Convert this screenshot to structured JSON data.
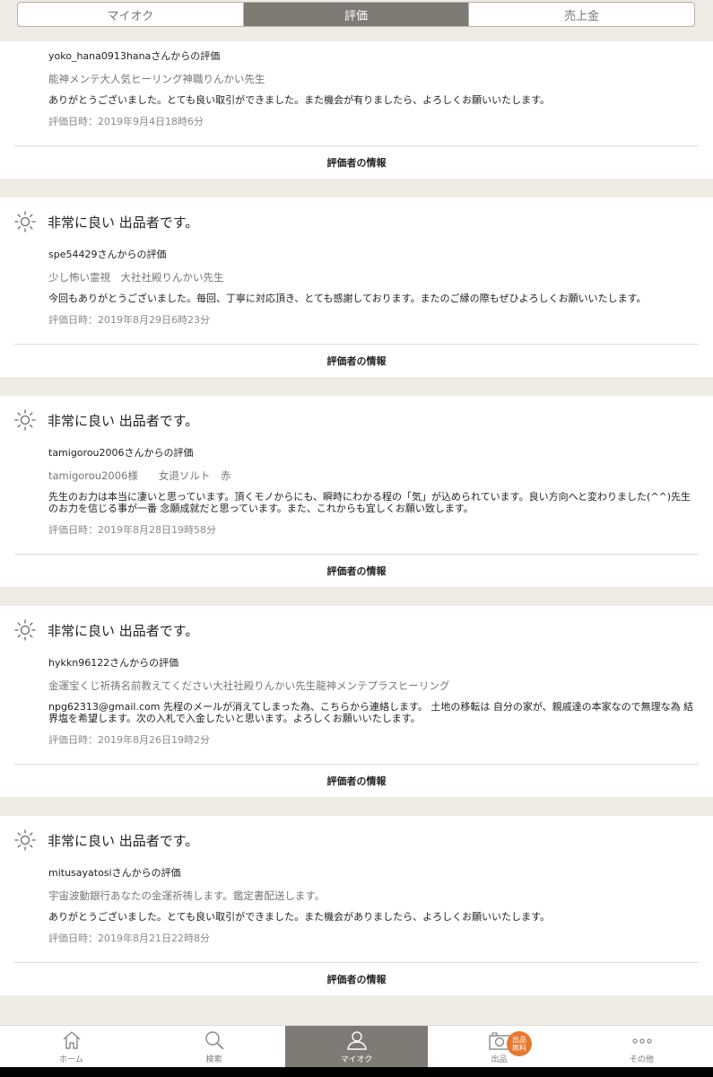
{
  "tabs": [
    {
      "label": "マイオク"
    },
    {
      "label": "評価"
    },
    {
      "label": "売上金"
    }
  ],
  "reviews": [
    {
      "rating": "",
      "from": "yoko_hana0913hanaさんからの評価",
      "item": "能神メンテ大人気ヒーリング神職りんかい先生",
      "comment": "ありがとうございました。とても良い取引ができました。また機会が有りましたら、よろしくお願いいたします。",
      "date": "評価日時：2019年9月4日18時6分",
      "info_label": "評価者の情報"
    },
    {
      "rating": "非常に良い 出品者です。",
      "from": "spe54429さんからの評価",
      "item": "少し怖い霊視　大社社殿りんかい先生",
      "comment": "今回もありがとうございました。毎回、丁寧に対応頂き、とても感謝しております。またのご縁の際もぜひよろしくお願いいたします。",
      "date": "評価日時：2019年8月29日6時23分",
      "info_label": "評価者の情報"
    },
    {
      "rating": "非常に良い 出品者です。",
      "from": "tamigorou2006さんからの評価",
      "item": "tamigorou2006様　　女退ソルト　赤",
      "comment": "先生のお力は本当に凄いと思っています。頂くモノからにも、瞬時にわかる程の「気」が込められています。良い方向へと変わりました(^^)先生のお力を信じる事が一番 念願成就だと思っています。また、これからも宜しくお願い致します。",
      "date": "評価日時：2019年8月28日19時58分",
      "info_label": "評価者の情報"
    },
    {
      "rating": "非常に良い 出品者です。",
      "from": "hykkn96122さんからの評価",
      "item": "金運宝くじ祈祷名前教えてください大社社殿りんかい先生龍神メンテプラスヒーリング",
      "comment": "npg62313@gmail.com 先程のメールが消えてしまった為、こちらから連絡します。 土地の移転は 自分の家が、親戚達の本家なので無理な為 結界塩を希望します。次の入札で入金したいと思います。よろしくお願いいたします。",
      "date": "評価日時：2019年8月26日19時2分",
      "info_label": "評価者の情報"
    },
    {
      "rating": "非常に良い 出品者です。",
      "from": "mitusayatosiさんからの評価",
      "item": "宇宙波動銀行あなたの金運祈祷します。鑑定書配送します。",
      "comment": "ありがとうございました。とても良い取引ができました。また機会がありましたら、よろしくお願いいたします。",
      "date": "評価日時：2019年8月21日22時8分",
      "info_label": "評価者の情報"
    }
  ],
  "bottom_nav": [
    {
      "label": "ホーム",
      "icon": "home-icon"
    },
    {
      "label": "検索",
      "icon": "search-icon"
    },
    {
      "label": "マイオク",
      "icon": "user-icon"
    },
    {
      "label": "出品",
      "icon": "camera-icon",
      "badge": "出品\n無料"
    },
    {
      "label": "その他",
      "icon": "more-icon"
    }
  ],
  "colors": {
    "accent": "#7e7a74",
    "badge": "#e8772e",
    "background": "#efece6"
  }
}
